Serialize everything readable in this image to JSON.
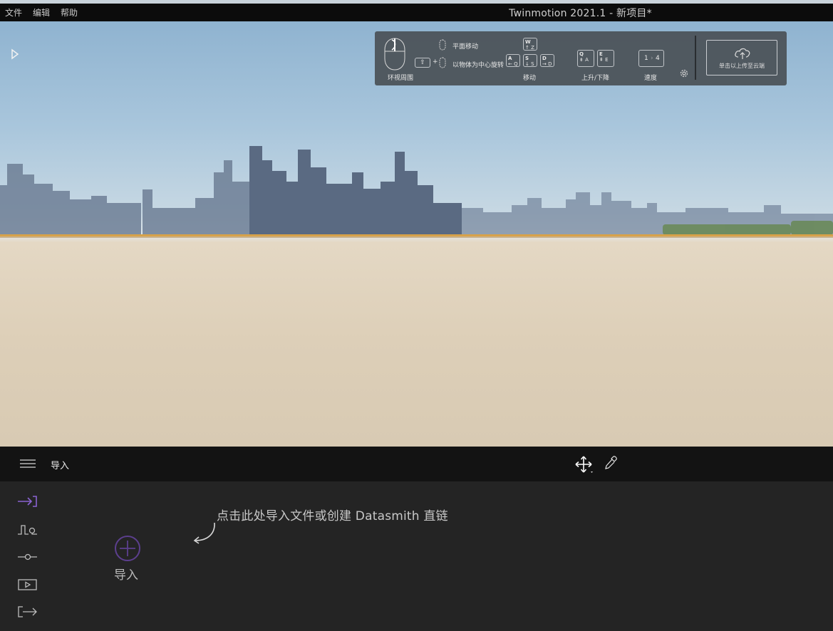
{
  "menu": {
    "items": [
      "文件",
      "编辑",
      "帮助"
    ],
    "title": "Twinmotion 2021.1 - 新项目*"
  },
  "nav_help": {
    "orbit_label": "环视周围",
    "pan_label": "平面移动",
    "rotate_label": "以物体为中心旋转",
    "move_label": "移动",
    "updown_label": "上升/下降",
    "speed_label": "速度",
    "keys": {
      "w": "W",
      "w_sub": "↑ Z",
      "a": "A",
      "a_sub": "← Q",
      "s": "S",
      "s_sub": "↓ S",
      "d": "D",
      "d_sub": "→ D",
      "q": "Q",
      "q_sub": "⇟ A",
      "e": "E",
      "e_sub": "⇞ E",
      "speed_from": "1",
      "speed_to": "4",
      "shift": "⇧",
      "plus": "+"
    },
    "cloud_label": "单击以上传至云端"
  },
  "bottom_bar": {
    "title": "导入"
  },
  "panel": {
    "import_label": "导入",
    "hint": "点击此处导入文件或创建 Datasmith 直链"
  },
  "colors": {
    "accent": "#8a63d2",
    "menubar": "#0c0c0c",
    "toolbar": "#131313",
    "panel": "#242424"
  },
  "icons": {
    "sidebar": [
      "import-icon",
      "context-icon",
      "configure-icon",
      "media-icon",
      "export-icon"
    ]
  }
}
